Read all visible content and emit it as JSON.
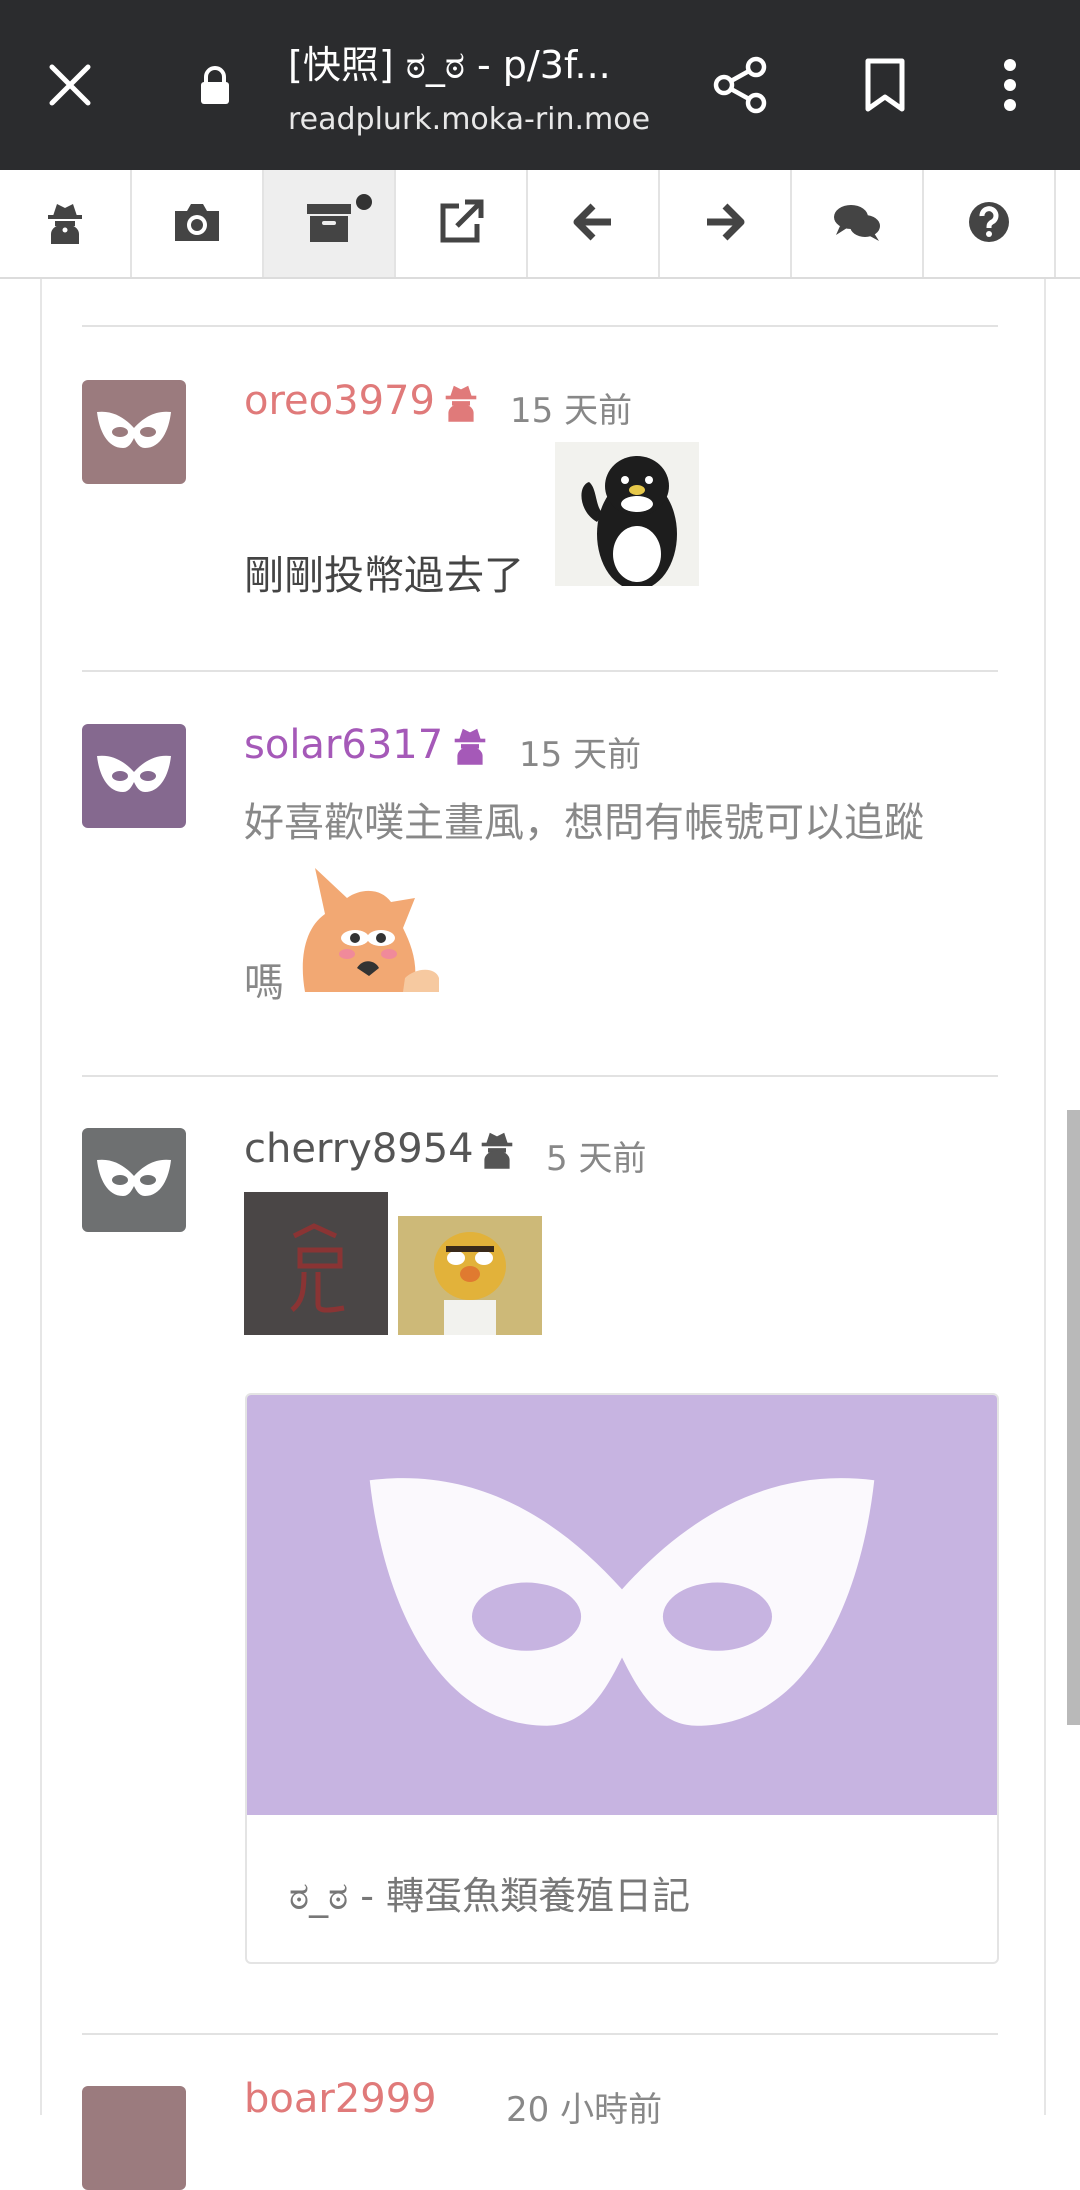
{
  "browser": {
    "title": "[快照] ಠ_ಠ - p/3f...",
    "url": "readplurk.moka-rin.moe"
  },
  "toolbar": {
    "buttons": [
      {
        "icon": "anonymous-icon"
      },
      {
        "icon": "camera-icon"
      },
      {
        "icon": "archive-icon",
        "active": true,
        "badge": true
      },
      {
        "icon": "external-link-icon"
      },
      {
        "icon": "arrow-left-icon"
      },
      {
        "icon": "arrow-right-icon"
      },
      {
        "icon": "comments-icon"
      },
      {
        "icon": "question-icon"
      }
    ]
  },
  "responses": [
    {
      "username": "oreo3979",
      "name_color": "#e07a7a",
      "avatar_color": "#9b7b7e",
      "time": "15 天前",
      "text": "剛剛投幣過去了",
      "stickers": [
        "penguin-thumbs-up"
      ]
    },
    {
      "username": "solar6317",
      "name_color": "#a559b8",
      "avatar_color": "#85698f",
      "time": "15 天前",
      "text_line1": "好喜歡噗主畫風，想問有帳號可以追蹤",
      "text_line2": "嗎",
      "stickers": [
        "fox-sticker"
      ]
    },
    {
      "username": "cherry8954",
      "name_color": "#555555",
      "avatar_color": "#6e7071",
      "time": "5 天前",
      "stickers": [
        "danger-red-image",
        "cartoon-character-image"
      ],
      "link_card": {
        "title": "ಠ_ಠ - 轉蛋魚類養殖日記",
        "image_color": "#c7b4e1"
      }
    },
    {
      "username": "boar2999",
      "name_color": "#e07a7a",
      "time": "20 小時前"
    }
  ]
}
